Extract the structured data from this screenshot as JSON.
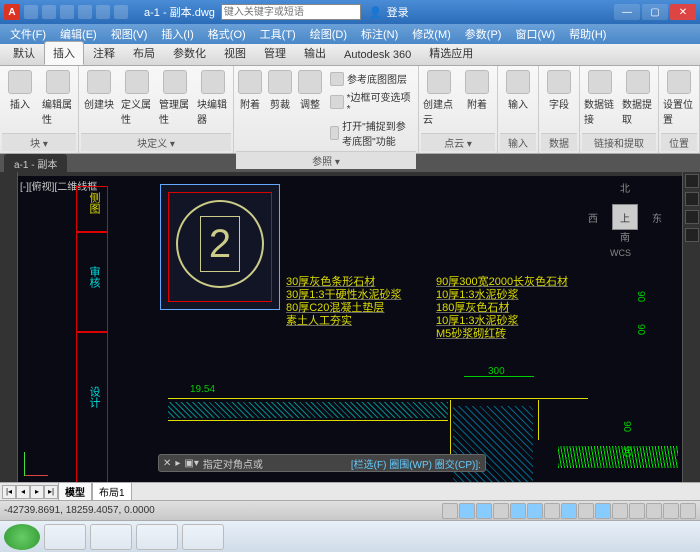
{
  "titlebar": {
    "logo": "A",
    "filename": "a-1 - 副本.dwg",
    "search_placeholder": "键入关键字或短语",
    "login": "登录"
  },
  "menubar": [
    "文件(F)",
    "编辑(E)",
    "视图(V)",
    "插入(I)",
    "格式(O)",
    "工具(T)",
    "绘图(D)",
    "标注(N)",
    "修改(M)",
    "参数(P)",
    "窗口(W)",
    "帮助(H)"
  ],
  "tabs": [
    "默认",
    "插入",
    "注释",
    "布局",
    "参数化",
    "视图",
    "管理",
    "输出",
    "Autodesk 360",
    "精选应用"
  ],
  "tabs_active": 1,
  "ribbon": {
    "panel1": {
      "label": "块 ▾",
      "big": [
        "插入",
        "编辑属性"
      ]
    },
    "panel2": {
      "label": "块定义 ▾",
      "big": [
        "创建块",
        "定义属性",
        "管理属性",
        "块编辑器"
      ]
    },
    "panel3": {
      "label": "参照 ▾",
      "big": [
        "附着",
        "剪裁",
        "调整"
      ],
      "rows": [
        "参考底图图层",
        "*边框可变选项*",
        "打开\"捕捉到参考底图\"功能"
      ]
    },
    "panel4": {
      "label": "点云 ▾",
      "big": [
        "创建点云",
        "附着"
      ]
    },
    "panel5": {
      "label": "输入",
      "big": [
        "输入"
      ]
    },
    "panel6": {
      "label": "数据",
      "big": [
        "字段"
      ]
    },
    "panel7": {
      "label": "链接和提取",
      "big": [
        "数据链接",
        "数据提取"
      ]
    },
    "panel8": {
      "label": "位置",
      "big": [
        "设置位置"
      ]
    }
  },
  "doctab": "a-1 - 副本",
  "canvas": {
    "viewlabel": "[-][俯视][二维线框",
    "side_labels": [
      "侧图",
      "审核",
      "设计"
    ],
    "circle_num": "2",
    "notes_left": [
      "30厚灰色条形石材",
      "30厚1:3干硬性水泥砂浆",
      "80厚C20混凝土垫层",
      "素土人工夯实"
    ],
    "notes_right": [
      "90厚300宽2000长灰色石材",
      "10厚1:3水泥砂浆",
      "180厚灰色石材",
      "10厚1:3水泥砂浆",
      "M5砂浆砌红砖"
    ],
    "dims": {
      "w300": "300",
      "w1954": "19.54",
      "h90a": "90",
      "h90b": "90",
      "h90c": "90",
      "h90d": "90"
    },
    "viewcube": {
      "n": "北",
      "s": "南",
      "e": "东",
      "w": "西",
      "face": "上",
      "wcs": "WCS"
    },
    "cmd_prompt": "指定对角点或",
    "cmd_opts": "[栏选(F) 圈围(WP) 圈交(CP)]:"
  },
  "layouts": {
    "tabs": [
      "模型",
      "布局1"
    ],
    "active": 0
  },
  "statusbar": {
    "coords": "-42739.8691, 18259.4057, 0.0000"
  }
}
